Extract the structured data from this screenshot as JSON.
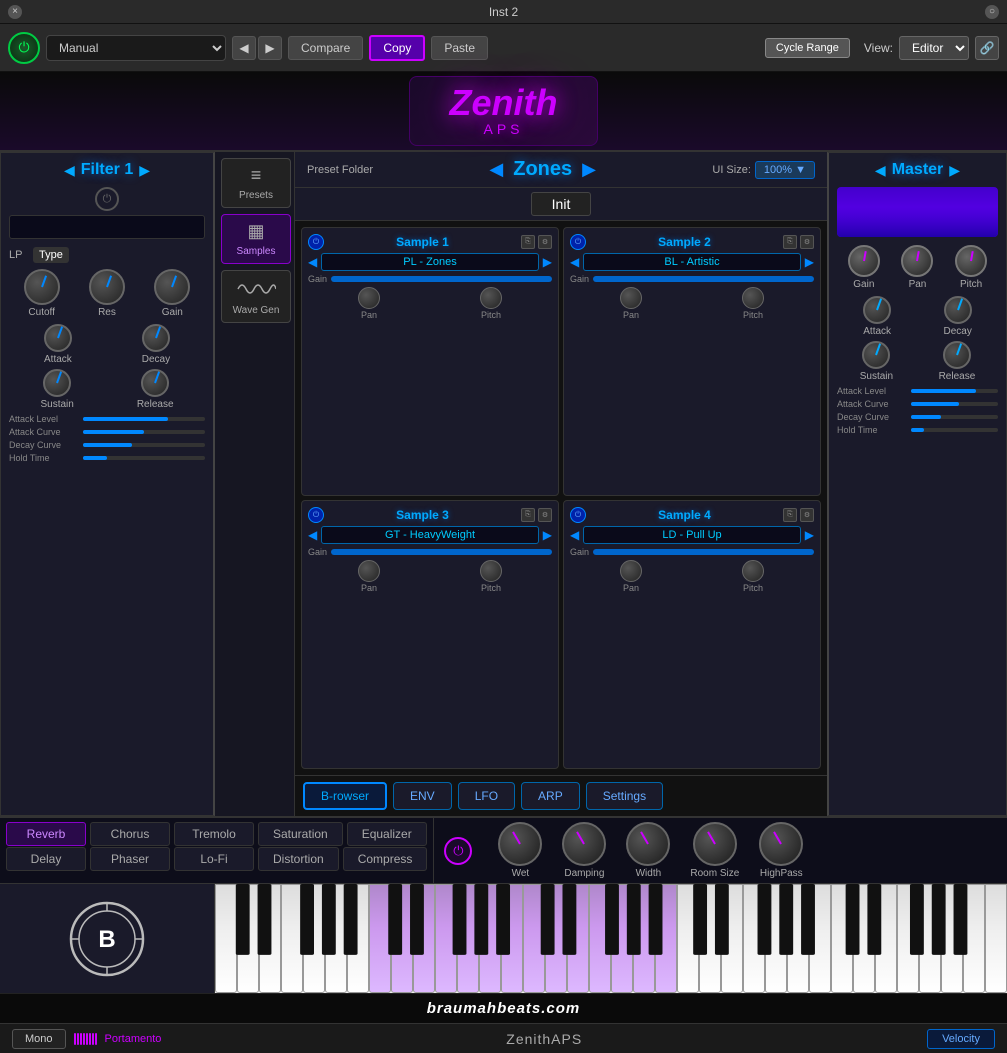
{
  "titleBar": {
    "title": "Inst 2",
    "close": "×",
    "maximize": "○"
  },
  "toolbar": {
    "preset": "Manual",
    "compare": "Compare",
    "copy": "Copy",
    "paste": "Paste",
    "cycleRange": "Cycle Range",
    "view": "View:",
    "viewValue": "Editor",
    "link": "🔗",
    "prevArrow": "◀",
    "nextArrow": "▶"
  },
  "logo": {
    "zenith": "Zenith",
    "aps": "APS"
  },
  "filter1": {
    "title": "Filter 1",
    "leftArrow": "◀",
    "rightArrow": "▶",
    "power": "⏻",
    "type": "LP",
    "typeLabel": "Type",
    "cutoffLabel": "Cutoff",
    "resLabel": "Res",
    "gainLabel": "Gain",
    "attackLabel": "Attack",
    "decayLabel": "Decay",
    "sustainLabel": "Sustain",
    "releaseLabel": "Release",
    "attackLevelLabel": "Attack Level",
    "attackCurveLabel": "Attack Curve",
    "decayCurveLabel": "Decay Curve",
    "holdTimeLabel": "Hold Time"
  },
  "presetBar": {
    "presetName": "Init",
    "uiSizeLabel": "UI Size:",
    "uiSizeValue": "100%",
    "dropArrow": "▼"
  },
  "zonesArea": {
    "presetFolder": "Preset Folder",
    "leftArrow": "◀",
    "title": "Zones",
    "rightArrow": "▶",
    "presetsLabel": "Presets",
    "samplesLabel": "Samples",
    "waveGenLabel": "Wave Gen",
    "presetsIcon": "≡",
    "samplesIcon": "▦"
  },
  "samples": [
    {
      "id": 1,
      "title": "Sample 1",
      "name": "PL - Zones",
      "gainLabel": "Gain",
      "panLabel": "Pan",
      "pitchLabel": "Pitch"
    },
    {
      "id": 2,
      "title": "Sample 2",
      "name": "BL - Artistic",
      "gainLabel": "Gain",
      "panLabel": "Pan",
      "pitchLabel": "Pitch"
    },
    {
      "id": 3,
      "title": "Sample 3",
      "name": "GT - HeavyWeight",
      "gainLabel": "Gain",
      "panLabel": "Pan",
      "pitchLabel": "Pitch"
    },
    {
      "id": 4,
      "title": "Sample 4",
      "name": "LD - Pull Up",
      "gainLabel": "Gain",
      "panLabel": "Pan",
      "pitchLabel": "Pitch"
    }
  ],
  "bottomBtns": {
    "browser": "B-rowser",
    "env": "ENV",
    "lfo": "LFO",
    "arp": "ARP",
    "settings": "Settings"
  },
  "master": {
    "title": "Master",
    "leftArrow": "◀",
    "rightArrow": "▶",
    "gainLabel": "Gain",
    "panLabel": "Pan",
    "pitchLabel": "Pitch",
    "attackLabel": "Attack",
    "decayLabel": "Decay",
    "sustainLabel": "Sustain",
    "releaseLabel": "Release",
    "attackLevelLabel": "Attack Level",
    "attackCurveLabel": "Attack Curve",
    "decayCurveLabel": "Decay Curve",
    "holdTimeLabel": "Hold Time"
  },
  "effectsTabs": [
    {
      "id": "reverb",
      "label": "Reverb",
      "active": true
    },
    {
      "id": "delay",
      "label": "Delay",
      "active": false
    },
    {
      "id": "chorus",
      "label": "Chorus",
      "active": false
    },
    {
      "id": "phaser",
      "label": "Phaser",
      "active": false
    },
    {
      "id": "tremolo",
      "label": "Tremolo",
      "active": false
    },
    {
      "id": "lofi",
      "label": "Lo-Fi",
      "active": false
    },
    {
      "id": "saturation",
      "label": "Saturation",
      "active": false
    },
    {
      "id": "distortion",
      "label": "Distortion",
      "active": false
    },
    {
      "id": "equalizer",
      "label": "Equalizer",
      "active": false
    },
    {
      "id": "compress",
      "label": "Compress",
      "active": false
    }
  ],
  "effectsKnobs": [
    {
      "label": "Wet"
    },
    {
      "label": "Damping"
    },
    {
      "label": "Width"
    },
    {
      "label": "Room Size"
    },
    {
      "label": "HighPass"
    }
  ],
  "pianoBottom": {
    "mono": "Mono",
    "portamento": "Portamento",
    "braumah": "braumahbeats.com",
    "velocity": "Velocity",
    "pluginName": "ZenithAPS"
  }
}
